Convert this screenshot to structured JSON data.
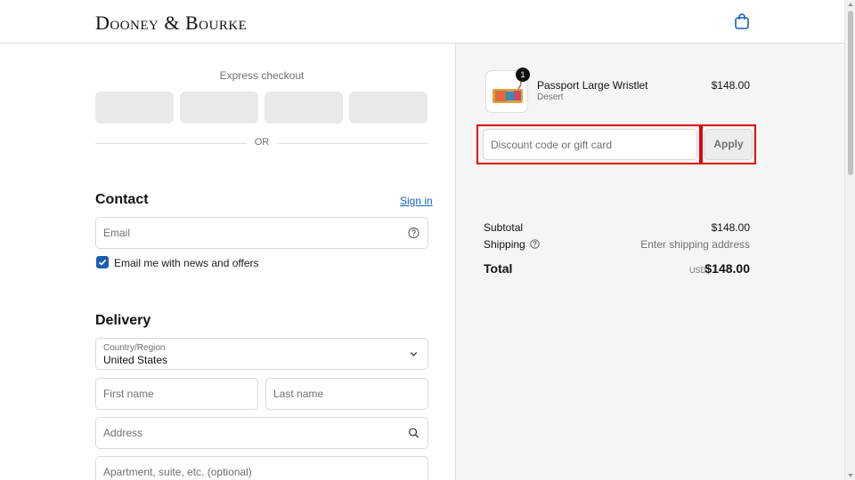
{
  "header": {
    "logo": "Dooney & Bourke",
    "cart_icon": "shopping-bag-icon"
  },
  "express": {
    "label": "Express checkout",
    "divider": "OR"
  },
  "contact": {
    "title": "Contact",
    "sign_in": "Sign in",
    "email_placeholder": "Email",
    "newsletter_label": "Email me with news and offers",
    "newsletter_checked": true
  },
  "delivery": {
    "title": "Delivery",
    "country_label": "Country/Region",
    "country_value": "United States",
    "first_name_placeholder": "First name",
    "last_name_placeholder": "Last name",
    "address_placeholder": "Address",
    "apartment_placeholder": "Apartment, suite, etc. (optional)"
  },
  "order": {
    "item": {
      "name": "Passport Large Wristlet",
      "variant": "Desert",
      "price": "$148.00",
      "quantity": "1"
    },
    "discount_placeholder": "Discount code or gift card",
    "apply_label": "Apply",
    "subtotal_label": "Subtotal",
    "subtotal_value": "$148.00",
    "shipping_label": "Shipping",
    "shipping_value": "Enter shipping address",
    "total_label": "Total",
    "total_currency": "USD",
    "total_value": "$148.00"
  },
  "colors": {
    "accent": "#1a5fb4",
    "highlight": "#e00000",
    "summary_bg": "#f5f5f5"
  }
}
